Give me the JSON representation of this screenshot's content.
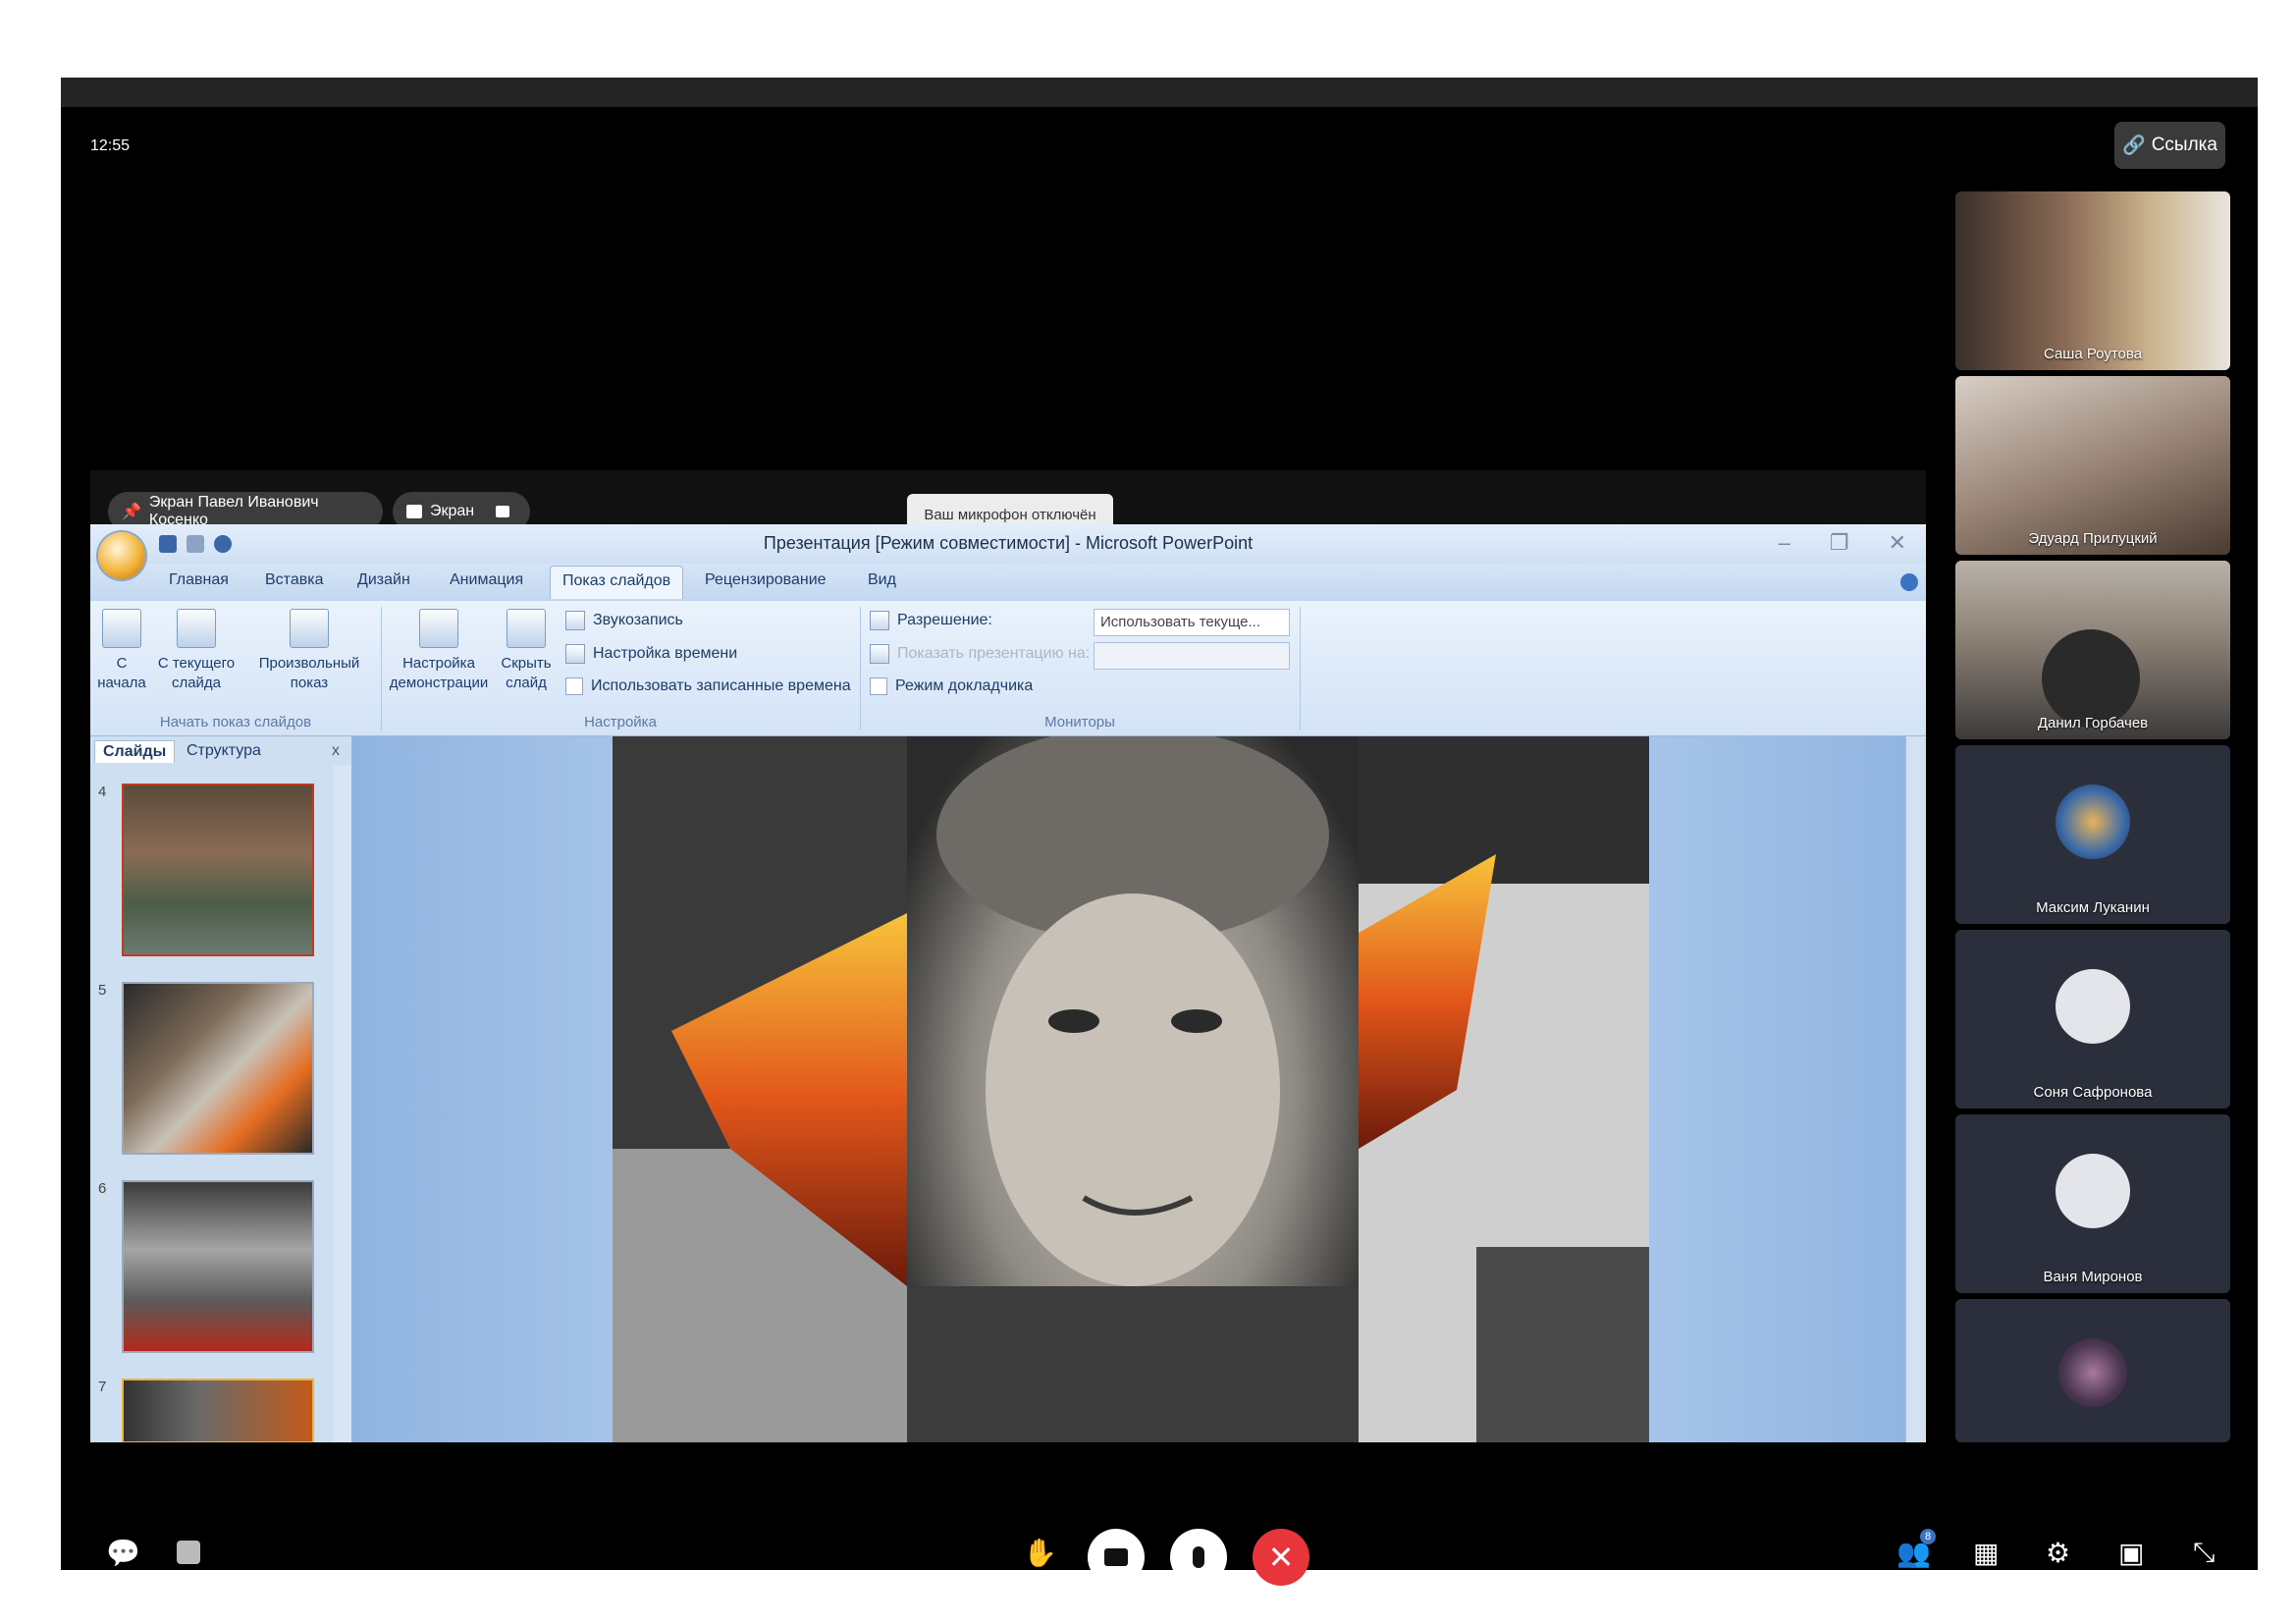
{
  "clock": "12:55",
  "link_button": "Ссылка",
  "share_chip_label": "Экран Павел Иванович Косенко",
  "screen_chip_label": "Экран",
  "mic_tooltip": "Ваш микрофон отключён",
  "ppt": {
    "title": "Презентация [Режим совместимости] - Microsoft PowerPoint",
    "tabs": [
      "Главная",
      "Вставка",
      "Дизайн",
      "Анимация",
      "Показ слайдов",
      "Рецензирование",
      "Вид"
    ],
    "ribbon": {
      "start_group": "Начать показ слайдов",
      "btn_from_start": "С начала",
      "btn_from_current": "С текущего слайда",
      "btn_custom": "Произвольный показ",
      "setup_group": "Настройка",
      "btn_setup": "Настройка демонстрации",
      "btn_hide": "Скрыть слайд",
      "record": "Звукозапись",
      "timing": "Настройка времени",
      "use_timings": "Использовать записанные времена",
      "monitors_group": "Мониторы",
      "resolution_label": "Разрешение:",
      "resolution_value": "Использовать текуще...",
      "show_on_label": "Показать презентацию на:",
      "presenter_view": "Режим докладчика"
    },
    "pane_tabs": [
      "Слайды",
      "Структура"
    ],
    "pane_close": "x",
    "thumb_numbers": [
      "4",
      "5",
      "6",
      "7"
    ]
  },
  "participants": [
    {
      "name": "Саша Роутова",
      "kind": "video"
    },
    {
      "name": "Эдуард Прилуцкий",
      "kind": "video"
    },
    {
      "name": "Данил Горбачев",
      "kind": "video"
    },
    {
      "name": "Максим Луканин",
      "kind": "photo"
    },
    {
      "name": "Соня Сафронова",
      "kind": "avatar"
    },
    {
      "name": "Ваня Миронов",
      "kind": "avatar"
    },
    {
      "name": "",
      "kind": "photo"
    }
  ],
  "participants_badge": "8",
  "colors": {
    "hangup": "#e8353b",
    "ribbon_text": "#1e3d6a",
    "accent": "#3a72c4"
  }
}
